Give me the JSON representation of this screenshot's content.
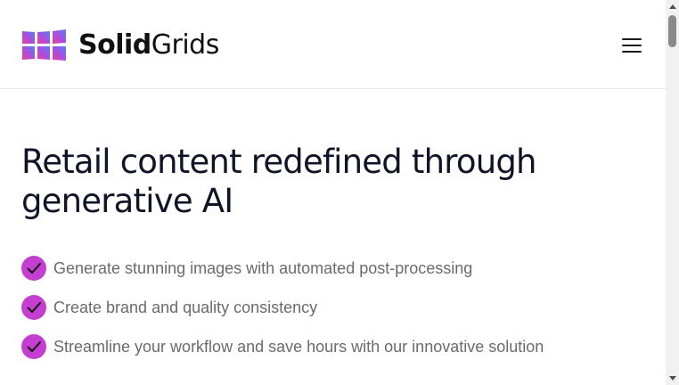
{
  "header": {
    "logo": {
      "bold_text": "Solid",
      "light_text": "Grids",
      "icon": "grid-logo-icon",
      "gradient_colors": [
        "#ec3d9a",
        "#a64fe0",
        "#5a7cf2"
      ]
    },
    "menu_icon": "hamburger-menu-icon"
  },
  "hero": {
    "title": "Retail content redefined through generative AI",
    "check_color": "#c43fd1",
    "features": [
      {
        "text": "Generate stunning images with automated post-processing",
        "icon": "check-icon"
      },
      {
        "text": "Create brand and quality consistency",
        "icon": "check-icon"
      },
      {
        "text": "Streamline your workflow and save hours with our innovative solution",
        "icon": "check-icon"
      }
    ]
  }
}
